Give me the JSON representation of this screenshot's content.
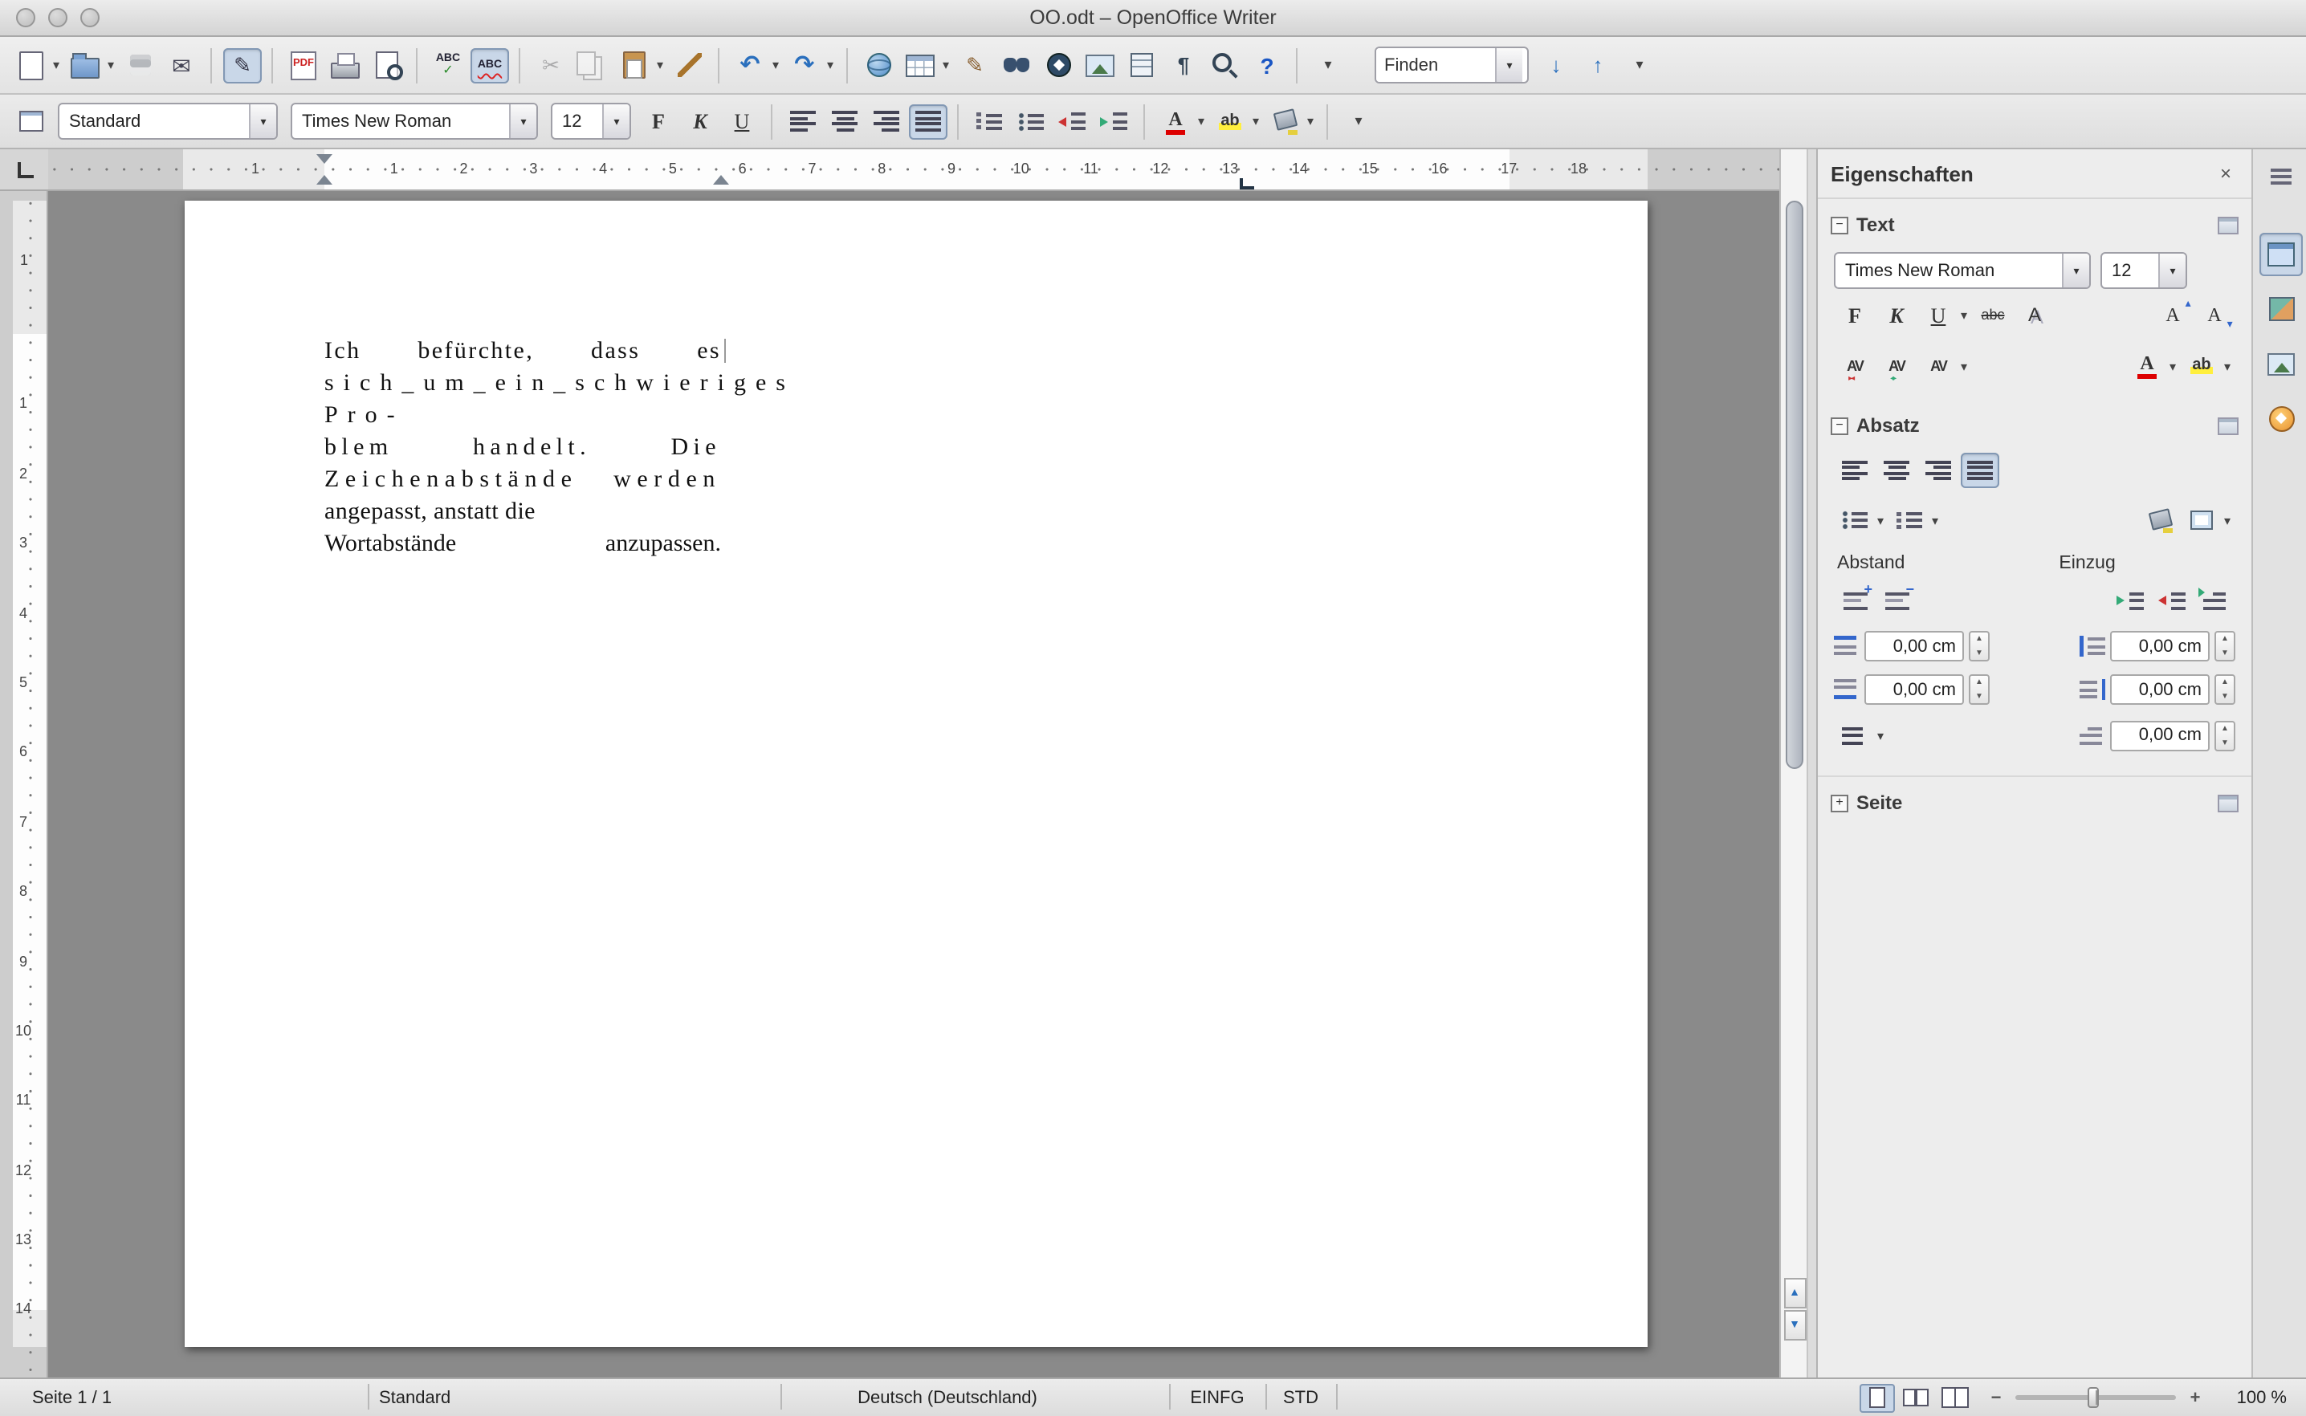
{
  "window": {
    "title": "OO.odt – OpenOffice Writer"
  },
  "toolbar_main": {
    "icons": [
      {
        "name": "new-document-icon",
        "glyph": "",
        "cls": "i-page dd"
      },
      {
        "name": "open-icon",
        "glyph": "",
        "cls": "i-folder dd"
      },
      {
        "name": "save-icon",
        "glyph": "",
        "cls": "i-floppy disabled"
      },
      {
        "name": "email-document-icon",
        "glyph": "✉",
        "cls": "i-mail sep"
      },
      {
        "name": "edit-file-icon",
        "glyph": "✎",
        "cls": "i-editdoc active sep"
      },
      {
        "name": "export-pdf-icon",
        "glyph": "PDF",
        "cls": "i-pdf"
      },
      {
        "name": "print-icon",
        "glyph": "",
        "cls": "i-printer"
      },
      {
        "name": "page-preview-icon",
        "glyph": "",
        "cls": "i-preview sep"
      },
      {
        "name": "spellcheck-icon",
        "glyph": "ABC",
        "cls": "i-abc"
      },
      {
        "name": "autospellcheck-icon",
        "glyph": "ABC",
        "cls": "i-abcauto active sep"
      },
      {
        "name": "cut-icon",
        "glyph": "✂",
        "cls": "i-cut disabled"
      },
      {
        "name": "copy-icon",
        "glyph": "",
        "cls": "i-copy disabled"
      },
      {
        "name": "paste-icon",
        "glyph": "",
        "cls": "i-clipboard dd"
      },
      {
        "name": "format-paintbrush-icon",
        "glyph": "",
        "cls": "i-brush sep"
      },
      {
        "name": "undo-icon",
        "glyph": "↶",
        "cls": "i-undo dd"
      },
      {
        "name": "redo-icon",
        "glyph": "↷",
        "cls": "i-redo dd sep"
      },
      {
        "name": "hyperlink-icon",
        "glyph": "",
        "cls": "i-globe"
      },
      {
        "name": "insert-table-icon",
        "glyph": "",
        "cls": "i-table dd"
      },
      {
        "name": "draw-functions-icon",
        "glyph": "✎",
        "cls": "i-draw"
      },
      {
        "name": "find-replace-icon",
        "glyph": "",
        "cls": "i-binoculars"
      },
      {
        "name": "navigator-icon",
        "glyph": "",
        "cls": "i-navigator"
      },
      {
        "name": "gallery-icon",
        "glyph": "",
        "cls": "i-gallery"
      },
      {
        "name": "data-sources-icon",
        "glyph": "",
        "cls": "i-datasource"
      },
      {
        "name": "nonprinting-characters-icon",
        "glyph": "¶",
        "cls": "i-pilcrow"
      },
      {
        "name": "zoom-icon",
        "glyph": "",
        "cls": "i-zoom"
      },
      {
        "name": "help-icon",
        "glyph": "?",
        "cls": "i-help sep"
      },
      {
        "name": "toolbar-more-icon",
        "glyph": "▾",
        "cls": "i-overflow"
      }
    ],
    "find_value": "Finden",
    "find_down": "↓",
    "find_up": "↑",
    "overflow2": "▾"
  },
  "toolbar_format": {
    "style_value": "Standard",
    "font_value": "Times New Roman",
    "size_value": "12",
    "buttons": [
      {
        "name": "bold-button",
        "glyph": "F",
        "cls": "t-bold"
      },
      {
        "name": "italic-button",
        "glyph": "K",
        "cls": "t-italic"
      },
      {
        "name": "underline-button",
        "glyph": "U",
        "cls": "t-under sep"
      },
      {
        "name": "align-left-button",
        "glyph": "",
        "cls": "i-align al"
      },
      {
        "name": "align-center-button",
        "glyph": "",
        "cls": "i-align ac"
      },
      {
        "name": "align-right-button",
        "glyph": "",
        "cls": "i-align ar"
      },
      {
        "name": "align-justify-button",
        "glyph": "",
        "cls": "i-align aj active sep"
      },
      {
        "name": "numbering-button",
        "glyph": "",
        "cls": "i-numlist"
      },
      {
        "name": "bullets-button",
        "glyph": "",
        "cls": "i-bullist"
      },
      {
        "name": "decrease-indent-button",
        "glyph": "",
        "cls": "i-outdent"
      },
      {
        "name": "increase-indent-button",
        "glyph": "",
        "cls": "i-indent sep"
      },
      {
        "name": "font-color-button",
        "glyph": "A",
        "cls": "i-fontcolor dd"
      },
      {
        "name": "highlighting-button",
        "glyph": "ab",
        "cls": "i-highlight dd"
      },
      {
        "name": "background-color-button",
        "glyph": "",
        "cls": "i-bgcolor dd sep"
      },
      {
        "name": "toolbar-more-icon",
        "glyph": "▾",
        "cls": "i-overflow"
      }
    ]
  },
  "ruler": {
    "h_margin": "1",
    "h": [
      "1",
      "2",
      "3",
      "4",
      "5",
      "6",
      "7",
      "8",
      "9",
      "10",
      "11",
      "12",
      "13",
      "14",
      "15",
      "16",
      "17",
      "18"
    ],
    "v_margin": "1",
    "v": [
      "1",
      "2",
      "3",
      "4",
      "5",
      "6",
      "7",
      "8",
      "9",
      "10",
      "11",
      "12",
      "13",
      "14"
    ]
  },
  "document": {
    "lines": [
      "Ich befürchte, dass es",
      "sich_um_ein_schwieriges Pro-",
      "blem handelt. Die",
      "Zeichenabstände werden",
      "angepasst, anstatt die",
      "Wortabstände anzupassen."
    ]
  },
  "sidebar": {
    "title": "Eigenschaften",
    "close_glyph": "×",
    "text": {
      "label": "Text",
      "collapse": "−",
      "font": "Times New Roman",
      "size": "12",
      "row1": [
        {
          "name": "bold-button",
          "glyph": "F",
          "cls": "t-bold"
        },
        {
          "name": "italic-button",
          "glyph": "K",
          "cls": "t-italic"
        },
        {
          "name": "underline-button",
          "glyph": "U",
          "cls": "t-under dd"
        },
        {
          "name": "strikethrough-button",
          "glyph": "abc",
          "cls": "t-strike"
        },
        {
          "name": "shadow-button",
          "glyph": "A",
          "cls": "t-shadow grow-gap"
        },
        {
          "name": "increase-font-button",
          "glyph": "A",
          "cls": "t-grow"
        },
        {
          "name": "decrease-font-button",
          "glyph": "A",
          "cls": "t-shrink"
        }
      ],
      "row2": [
        {
          "name": "decrease-char-spacing-button",
          "glyph": "AV",
          "cls": "t-spc t-spc-dec"
        },
        {
          "name": "increase-char-spacing-button",
          "glyph": "AV",
          "cls": "t-spc t-spc-inc"
        },
        {
          "name": "char-spacing-button",
          "glyph": "AV",
          "cls": "t-spc dd grow-gap"
        },
        {
          "name": "font-color-button",
          "glyph": "A",
          "cls": "i-fontcolor dd"
        },
        {
          "name": "highlighting-button",
          "glyph": "ab",
          "cls": "i-highlight dd"
        }
      ]
    },
    "paragraph": {
      "label": "Absatz",
      "collapse": "−",
      "spacing_label": "Abstand",
      "indent_label": "Einzug",
      "align_row": [
        {
          "name": "align-left-button",
          "glyph": "",
          "cls": "i-align al"
        },
        {
          "name": "align-center-button",
          "glyph": "",
          "cls": "i-align ac"
        },
        {
          "name": "align-right-button",
          "glyph": "",
          "cls": "i-align ar"
        },
        {
          "name": "align-justify-button",
          "glyph": "",
          "cls": "i-align aj active"
        }
      ],
      "list_row": [
        {
          "name": "bullets-button",
          "glyph": "",
          "cls": "i-bullist dd"
        },
        {
          "name": "numbering-button",
          "glyph": "",
          "cls": "i-numlist dd grow-gap"
        },
        {
          "name": "paragraph-background-button",
          "glyph": "",
          "cls": "i-bgcolor"
        },
        {
          "name": "paragraph-border-button",
          "glyph": "",
          "cls": "i-frame dd"
        }
      ],
      "spacing_buttons": [
        {
          "name": "increase-paragraph-spacing-button",
          "glyph": "",
          "cls": "i-parspc p-inc"
        },
        {
          "name": "decrease-paragraph-spacing-button",
          "glyph": "",
          "cls": "i-parspc p-dec"
        }
      ],
      "indent_buttons": [
        {
          "name": "increase-indent-button",
          "glyph": "",
          "cls": "i-indent"
        },
        {
          "name": "decrease-indent-button",
          "glyph": "",
          "cls": "i-outdent"
        },
        {
          "name": "hanging-indent-button",
          "glyph": "",
          "cls": "i-hang"
        }
      ],
      "fields": {
        "above": "0,00 cm",
        "below": "0,00 cm",
        "before": "0,00 cm",
        "after": "0,00 cm",
        "firstline": "0,00 cm"
      }
    },
    "page": {
      "label": "Seite",
      "collapse": "+"
    }
  },
  "tabs": [
    {
      "name": "properties-tab",
      "glyph": "",
      "cls": "i-props active"
    },
    {
      "name": "styles-tab",
      "glyph": "",
      "cls": "i-styles"
    },
    {
      "name": "gallery-tab",
      "glyph": "",
      "cls": "i-gallerytab"
    },
    {
      "name": "navigator-tab",
      "glyph": "",
      "cls": "i-navtab"
    }
  ],
  "statusbar": {
    "page": "Seite 1 / 1",
    "style": "Standard",
    "language": "Deutsch (Deutschland)",
    "insert": "EINFG",
    "selection": "STD",
    "zoom_out": "−",
    "zoom_in": "+",
    "zoom": "100 %"
  }
}
